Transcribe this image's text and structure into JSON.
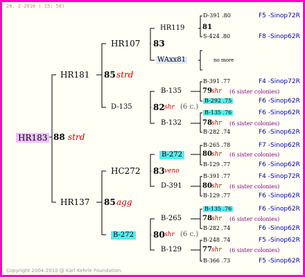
{
  "header": "28. 2-2010 ( 15: 58)",
  "footer": "Copyright 2004-2010 @ Karl Kehrle Foundation.",
  "nodes": {
    "root": {
      "name": "HR183",
      "num": "88",
      "note": "strd"
    },
    "p1": {
      "name": "HR181",
      "num": "85",
      "note": "strd"
    },
    "p2": {
      "name": "HR137",
      "num": "85",
      "note": "agg"
    },
    "g1": {
      "name": "HR107",
      "num": "83"
    },
    "g2": {
      "name": "D-135",
      "num": "82",
      "note": "shr",
      "extra": "(6 c.)"
    },
    "g3": {
      "name": "HC272",
      "num": "83",
      "note": "veno"
    },
    "g4": {
      "name": "B-272",
      "num": "80",
      "note": "shr",
      "extra": "(6 c.)"
    },
    "gg1": {
      "name": "HR119",
      "num": "81"
    },
    "gg2": {
      "name": "WAxx81",
      "nomore": "no more"
    },
    "gg3": {
      "name": "B-135",
      "num": "79",
      "note": "shr",
      "extra": "(6 sister colonies)"
    },
    "gg4": {
      "name": "B-132",
      "num": "78",
      "note": "shr",
      "extra": "(6 sister colonies)"
    },
    "gg5": {
      "name": "B-272",
      "num": "80",
      "note": "shr",
      "extra": "(6 sister colonies)"
    },
    "gg6": {
      "name": "D-391",
      "num": "80",
      "note": "shr",
      "extra": "(6 sister colonies)"
    },
    "gg7": {
      "name": "B-265",
      "num": "78",
      "note": "shr",
      "extra": "(6 sister colonies)"
    },
    "gg8": {
      "name": "B-129",
      "num": "77",
      "note": "shr",
      "extra": "(6 sister colonies)"
    }
  },
  "leaves": [
    {
      "id": "D-391 .80",
      "code": "F5 -Sinop72R"
    },
    {
      "id": "S-424 .80",
      "code": "F8 -Sinop62R"
    },
    {
      "id": "B-391 .77",
      "code": "F4 -Sinop72R"
    },
    {
      "id": "B-292 .75",
      "code": "F6 -Sinop62R"
    },
    {
      "id": "B-135 .76",
      "code": "F6 -Sinop62R"
    },
    {
      "id": "B-282 .74",
      "code": "F6 -Sinop62R"
    },
    {
      "id": "B-265 .78",
      "code": "F7 -Sinop62R"
    },
    {
      "id": "B-129 .77",
      "code": "F6 -Sinop62R"
    },
    {
      "id": "B-391 .77",
      "code": "F4 -Sinop72R"
    },
    {
      "id": "B-129 .77",
      "code": "F6 -Sinop62R"
    },
    {
      "id": "B-135 .76",
      "code": "F6 -Sinop62R"
    },
    {
      "id": "B-282 .74",
      "code": "F6 -Sinop62R"
    },
    {
      "id": "B-248 .74",
      "code": "F5 -Sinop62R"
    },
    {
      "id": "B-366 .73",
      "code": "F5 -Sinop62R"
    }
  ]
}
